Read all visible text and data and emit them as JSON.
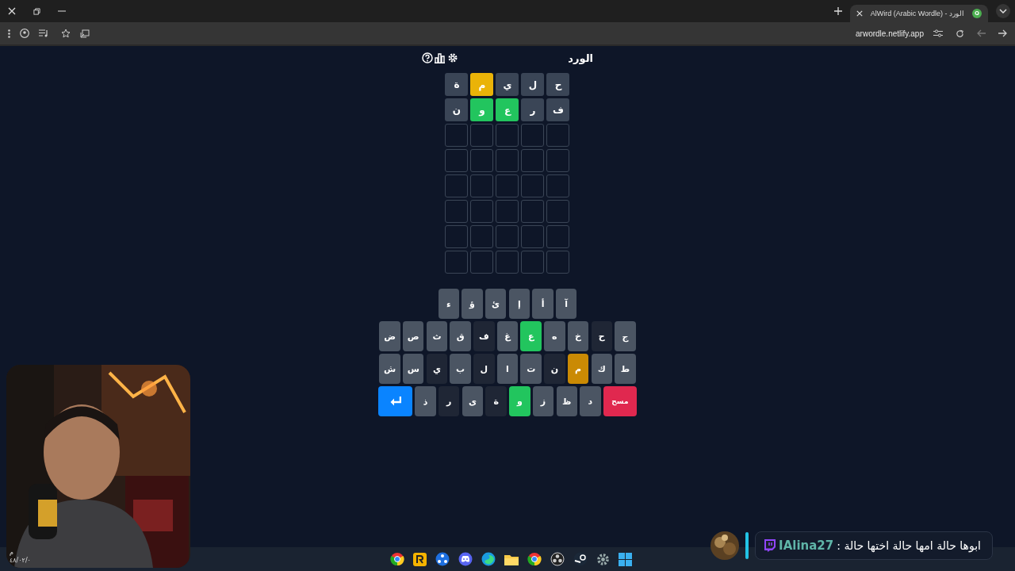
{
  "browser": {
    "tabs": [
      {
        "title": "AlWird (Arabic Wordle) - الورد",
        "selected": true
      }
    ],
    "url": "arwordle.netlify.app"
  },
  "game": {
    "title": "الورد",
    "grid": [
      [
        {
          "letter": "ح",
          "color": "#3a4556"
        },
        {
          "letter": "ل",
          "color": "#3a4556"
        },
        {
          "letter": "ي",
          "color": "#3a4556"
        },
        {
          "letter": "م",
          "color": "#eab308"
        },
        {
          "letter": "ة",
          "color": "#3a4556"
        }
      ],
      [
        {
          "letter": "ف",
          "color": "#3a4556"
        },
        {
          "letter": "ر",
          "color": "#3a4556"
        },
        {
          "letter": "ع",
          "color": "#22c55e"
        },
        {
          "letter": "و",
          "color": "#22c55e"
        },
        {
          "letter": "ن",
          "color": "#3a4556"
        }
      ],
      [
        {
          "kind": "empty"
        },
        {
          "kind": "empty"
        },
        {
          "kind": "empty"
        },
        {
          "kind": "empty"
        },
        {
          "kind": "empty"
        }
      ],
      [
        {
          "kind": "empty"
        },
        {
          "kind": "empty"
        },
        {
          "kind": "empty"
        },
        {
          "kind": "empty"
        },
        {
          "kind": "empty"
        }
      ],
      [
        {
          "kind": "empty"
        },
        {
          "kind": "empty"
        },
        {
          "kind": "empty"
        },
        {
          "kind": "empty"
        },
        {
          "kind": "empty"
        }
      ],
      [
        {
          "kind": "empty"
        },
        {
          "kind": "empty"
        },
        {
          "kind": "empty"
        },
        {
          "kind": "empty"
        },
        {
          "kind": "empty"
        }
      ],
      [
        {
          "kind": "empty"
        },
        {
          "kind": "empty"
        },
        {
          "kind": "empty"
        },
        {
          "kind": "empty"
        },
        {
          "kind": "empty"
        }
      ],
      [
        {
          "kind": "empty"
        },
        {
          "kind": "empty"
        },
        {
          "kind": "empty"
        },
        {
          "kind": "empty"
        },
        {
          "kind": "empty"
        }
      ]
    ],
    "keyboard": [
      [
        {
          "kind": "letter",
          "label": "آ",
          "color": "#4b5563"
        },
        {
          "kind": "letter",
          "label": "أ",
          "color": "#4b5563"
        },
        {
          "kind": "letter",
          "label": "إ",
          "color": "#4b5563"
        },
        {
          "kind": "letter",
          "label": "ئ",
          "color": "#4b5563"
        },
        {
          "kind": "letter",
          "label": "ؤ",
          "color": "#4b5563"
        },
        {
          "kind": "letter",
          "label": "ء",
          "color": "#4b5563"
        }
      ],
      [
        {
          "kind": "letter",
          "label": "ج",
          "color": "#4b5563"
        },
        {
          "kind": "letter",
          "label": "ح",
          "color": "#1f2635"
        },
        {
          "kind": "letter",
          "label": "خ",
          "color": "#4b5563"
        },
        {
          "kind": "letter",
          "label": "ه",
          "color": "#4b5563"
        },
        {
          "kind": "letter",
          "label": "ع",
          "color": "#22c55e"
        },
        {
          "kind": "letter",
          "label": "غ",
          "color": "#4b5563"
        },
        {
          "kind": "letter",
          "label": "ف",
          "color": "#1f2635"
        },
        {
          "kind": "letter",
          "label": "ق",
          "color": "#4b5563"
        },
        {
          "kind": "letter",
          "label": "ث",
          "color": "#4b5563"
        },
        {
          "kind": "letter",
          "label": "ص",
          "color": "#4b5563"
        },
        {
          "kind": "letter",
          "label": "ض",
          "color": "#4b5563"
        }
      ],
      [
        {
          "kind": "letter",
          "label": "ط",
          "color": "#4b5563"
        },
        {
          "kind": "letter",
          "label": "ك",
          "color": "#4b5563"
        },
        {
          "kind": "letter",
          "label": "م",
          "color": "#ca8a04"
        },
        {
          "kind": "letter",
          "label": "ن",
          "color": "#1f2635"
        },
        {
          "kind": "letter",
          "label": "ت",
          "color": "#4b5563"
        },
        {
          "kind": "letter",
          "label": "ا",
          "color": "#4b5563"
        },
        {
          "kind": "letter",
          "label": "ل",
          "color": "#1f2635"
        },
        {
          "kind": "letter",
          "label": "ب",
          "color": "#4b5563"
        },
        {
          "kind": "letter",
          "label": "ي",
          "color": "#1f2635"
        },
        {
          "kind": "letter",
          "label": "س",
          "color": "#4b5563"
        },
        {
          "kind": "letter",
          "label": "ش",
          "color": "#4b5563"
        }
      ],
      [
        {
          "kind": "delete",
          "label": "مسح"
        },
        {
          "kind": "letter",
          "label": "د",
          "color": "#4b5563"
        },
        {
          "kind": "letter",
          "label": "ظ",
          "color": "#4b5563"
        },
        {
          "kind": "letter",
          "label": "ز",
          "color": "#4b5563"
        },
        {
          "kind": "letter",
          "label": "و",
          "color": "#22c55e"
        },
        {
          "kind": "letter",
          "label": "ة",
          "color": "#1f2635"
        },
        {
          "kind": "letter",
          "label": "ى",
          "color": "#4b5563"
        },
        {
          "kind": "letter",
          "label": "ر",
          "color": "#1f2635"
        },
        {
          "kind": "letter",
          "label": "ذ",
          "color": "#4b5563"
        },
        {
          "kind": "enter"
        }
      ]
    ]
  },
  "chat": {
    "username": "IAlina27",
    "message": "ابوها حالة امها حالة اختها حالة :"
  },
  "clock": {
    "time": "م",
    "date": "٤٨/٠٢/٠"
  }
}
